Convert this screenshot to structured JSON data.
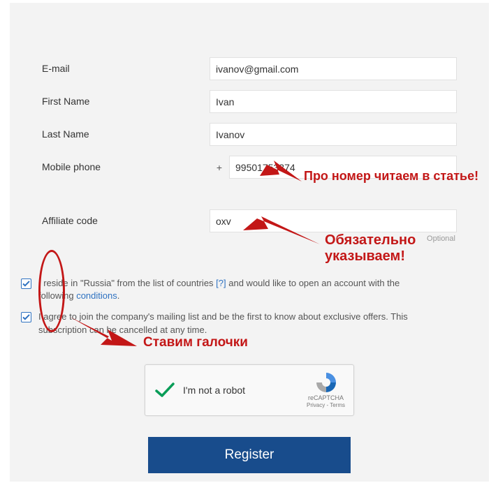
{
  "form": {
    "email_label": "E-mail",
    "email_value": "ivanov@gmail.com",
    "firstname_label": "First Name",
    "firstname_value": "Ivan",
    "lastname_label": "Last Name",
    "lastname_value": "Ivanov",
    "mobile_label": "Mobile phone",
    "mobile_plus": "+",
    "mobile_value": "99501753374",
    "affiliate_label": "Affiliate code",
    "affiliate_value": "oxv",
    "optional_hint": "Optional"
  },
  "checks": {
    "c1_pre": "I reside in \"Russia\" from the list of countries ",
    "c1_qmark": "[?]",
    "c1_mid": " and would like to open an account with the following ",
    "c1_link": "conditions",
    "c1_post": ".",
    "c2": "I agree to join the company's mailing list and be the first to know about exclusive offers. This subscription can be cancelled at any time."
  },
  "recaptcha": {
    "text": "I'm not a robot",
    "brand": "reCAPTCHA",
    "privacy": "Privacy",
    "dash": " - ",
    "terms": "Terms"
  },
  "register": "Register",
  "annotations": {
    "phone_note": "Про номер читаем в статье!",
    "aff_note1": "Обязательно",
    "aff_note2": "указываем!",
    "checks_note": "Ставим галочки"
  }
}
